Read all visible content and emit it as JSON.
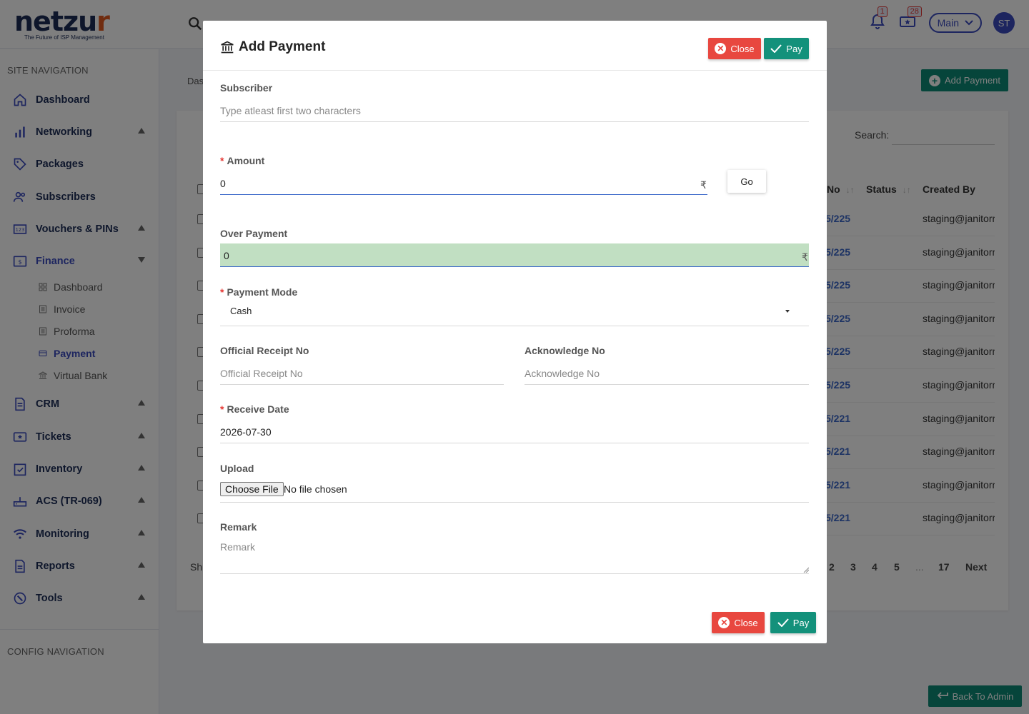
{
  "brand": {
    "name_main": "netzu",
    "name_dot": "r",
    "tagline": "The Future of ISP Management"
  },
  "topbar": {
    "notifications_count": "1",
    "tickets_count": "28",
    "workspace": "Main",
    "avatar_initials": "ST"
  },
  "sidebar": {
    "site_heading": "SITE NAVIGATION",
    "config_heading": "CONFIG NAVIGATION",
    "items": [
      {
        "label": "Dashboard",
        "icon": "home-icon"
      },
      {
        "label": "Networking",
        "icon": "bar-chart-icon"
      },
      {
        "label": "Packages",
        "icon": "tag-icon"
      },
      {
        "label": "Subscribers",
        "icon": "users-icon"
      },
      {
        "label": "Vouchers & PINs",
        "icon": "pin-pad-icon"
      },
      {
        "label": "Finance",
        "icon": "dollar-icon"
      },
      {
        "label": "CRM",
        "icon": "document-icon"
      },
      {
        "label": "Tickets",
        "icon": "ticket-icon"
      },
      {
        "label": "Inventory",
        "icon": "clipboard-check-icon"
      },
      {
        "label": "ACS (TR-069)",
        "icon": "router-icon"
      },
      {
        "label": "Monitoring",
        "icon": "wifi-icon"
      },
      {
        "label": "Reports",
        "icon": "report-icon"
      },
      {
        "label": "Tools",
        "icon": "wrench-icon"
      }
    ],
    "finance_sub": [
      {
        "label": "Dashboard"
      },
      {
        "label": "Invoice"
      },
      {
        "label": "Proforma"
      },
      {
        "label": "Payment"
      },
      {
        "label": "Virtual Bank"
      }
    ]
  },
  "page": {
    "breadcrumb": "Das",
    "add_payment_label": "Add Payment",
    "search_label": "Search:",
    "col_no": "No",
    "col_status": "Status",
    "col_created_by": "Created By",
    "rows": [
      {
        "no": "5/225",
        "created_by": "staging@janitorra"
      },
      {
        "no": "5/225",
        "created_by": "staging@janitorra"
      },
      {
        "no": "5/225",
        "created_by": "staging@janitorra"
      },
      {
        "no": "5/225",
        "created_by": "staging@janitorra"
      },
      {
        "no": "5/225",
        "created_by": "staging@janitorra"
      },
      {
        "no": "5/225",
        "created_by": "staging@janitorra"
      },
      {
        "no": "5/221",
        "created_by": "staging@janitorra"
      },
      {
        "no": "5/221",
        "created_by": "staging@janitorra"
      },
      {
        "no": "5/221",
        "created_by": "staging@janitorra"
      },
      {
        "no": "5/221",
        "created_by": "staging@janitorra"
      }
    ],
    "show_text": "Sh",
    "pager": [
      "2",
      "3",
      "4",
      "5",
      "...",
      "17",
      "Next"
    ],
    "back_to_admin": "Back To Admin"
  },
  "modal": {
    "title": "Add Payment",
    "close_label": "Close",
    "pay_label": "Pay",
    "subscriber_label": "Subscriber",
    "subscriber_placeholder": "Type atleast first two characters",
    "amount_label": "Amount",
    "amount_value": "0",
    "currency_symbol": "₹",
    "go_label": "Go",
    "over_payment_label": "Over Payment",
    "over_payment_value": "0",
    "payment_mode_label": "Payment Mode",
    "payment_mode_value": "Cash",
    "official_receipt_label": "Official Receipt No",
    "official_receipt_placeholder": "Official Receipt No",
    "acknowledge_label": "Acknowledge No",
    "acknowledge_placeholder": "Acknowledge No",
    "receive_date_label": "Receive Date",
    "receive_date_value": "2026-07-30",
    "upload_label": "Upload",
    "choose_file_label": "Choose File",
    "no_file_text": "No file chosen",
    "remark_label": "Remark",
    "remark_placeholder": "Remark",
    "required_mark": "*"
  },
  "colors": {
    "brand_navy": "#1c2d57",
    "accent_blue": "#3a4bbf",
    "close_red": "#e8473f",
    "pay_teal": "#13917b",
    "over_payment_bg": "#c1dfc2"
  }
}
